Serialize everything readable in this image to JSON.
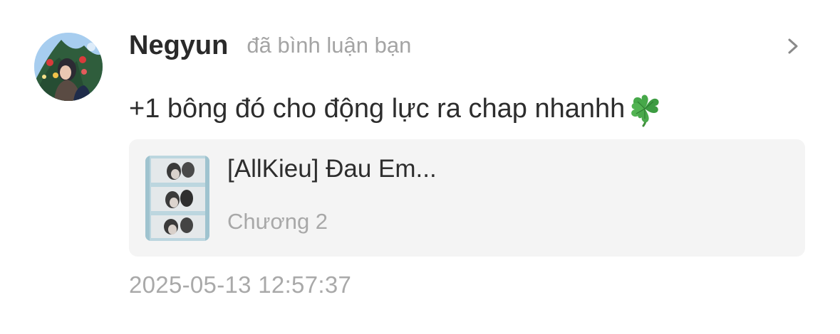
{
  "notification": {
    "user_name": "Negyun",
    "action_text": "đã bình luận bạn",
    "comment_text": "+1 bông đó cho động lực ra chap nhanhh",
    "comment_emoji": "four-leaf-clover",
    "timestamp": "2025-05-13 12:57:37"
  },
  "story_card": {
    "title": "[AllKieu] Đau Em...",
    "chapter": "Chương 2"
  },
  "icons": {
    "avatar": "user-avatar-photo",
    "chevron": "chevron-right-icon",
    "cover": "story-cover-thumbnail"
  },
  "colors": {
    "primary_text": "#2b2b2b",
    "secondary_text": "#a4a4a4",
    "card_background": "#f4f4f4",
    "emoji_green": "#3da34a"
  }
}
